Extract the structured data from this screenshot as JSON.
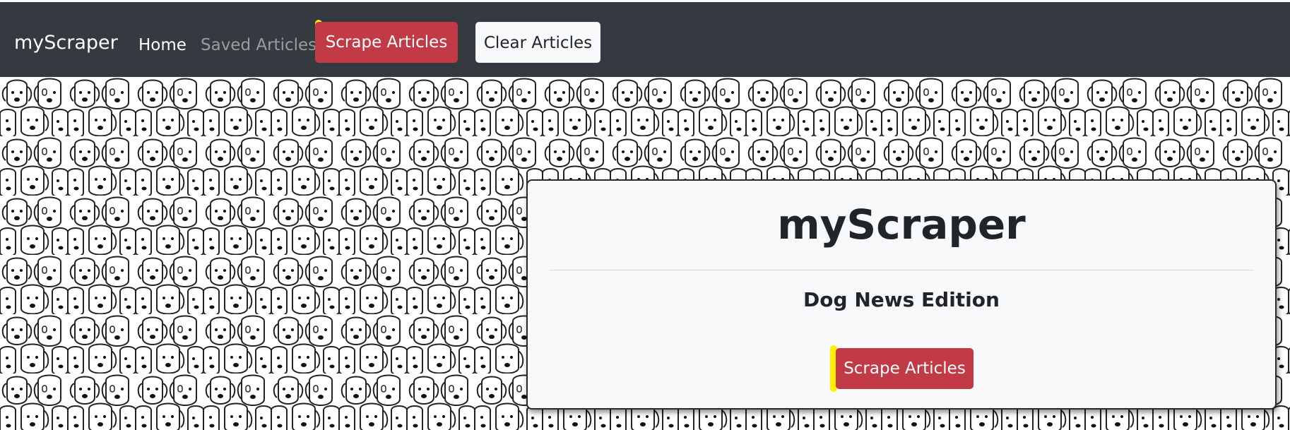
{
  "navbar": {
    "brand": "myScraper",
    "home": "Home",
    "saved": "Saved Articles",
    "scrape": "Scrape Articles",
    "clear": "Clear Articles"
  },
  "jumbotron": {
    "title": "myScraper",
    "subtitle": "Dog News Edition",
    "scrape": "Scrape Articles"
  },
  "colors": {
    "navbar_bg": "#343a40",
    "danger": "#c13a45",
    "light": "#f8f9fa",
    "highlight": "#ffef00"
  },
  "background": {
    "icon": "dog-faces-pattern-icon"
  }
}
